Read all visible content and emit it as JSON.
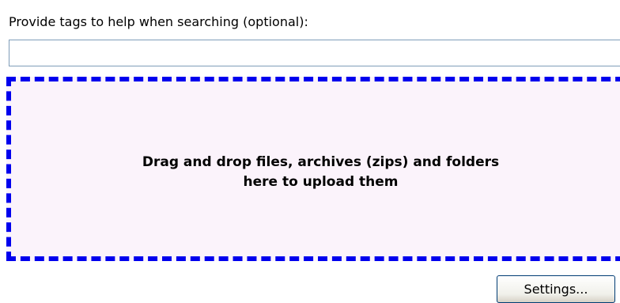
{
  "tags": {
    "label": "Provide tags to help when searching (optional):",
    "value": "",
    "placeholder": ""
  },
  "drop_zone": {
    "line1": "Drag and drop files, archives (zips) and folders",
    "line2": "here to upload them",
    "border_color": "#0000ee",
    "background_color": "#fbf3fb"
  },
  "footer": {
    "settings_label": "Settings..."
  }
}
